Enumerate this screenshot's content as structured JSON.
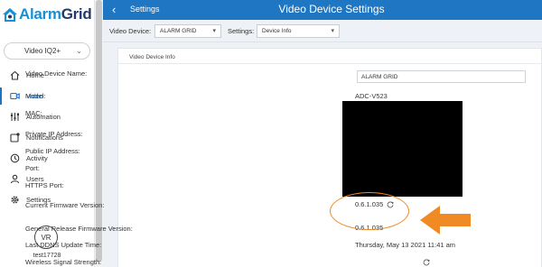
{
  "brand": {
    "alarm": "Alarm",
    "grid": "Grid",
    "alarm_color": "#1a8fd4",
    "grid_color": "#223a6b"
  },
  "system_selector": {
    "value": "Video IQ2+"
  },
  "nav": [
    {
      "label": "Home",
      "icon": "home-icon",
      "active": false
    },
    {
      "label": "Video",
      "icon": "video-camera-icon",
      "active": true
    },
    {
      "label": "Automation",
      "icon": "automation-icon",
      "active": false
    },
    {
      "label": "Notifications",
      "icon": "notifications-icon",
      "active": false
    },
    {
      "label": "Activity",
      "icon": "activity-icon",
      "active": false
    },
    {
      "label": "Users",
      "icon": "users-icon",
      "active": false
    },
    {
      "label": "Settings",
      "icon": "gear-icon",
      "active": false
    }
  ],
  "user": {
    "initials": "VR",
    "username": "test17728"
  },
  "header": {
    "back_label": "Settings",
    "title": "Video Device Settings",
    "color": "#1f76c3"
  },
  "toolbar": {
    "device_label": "Video Device:",
    "device_value": "ALARM GRID",
    "settings_label": "Settings:",
    "settings_value": "Device Info"
  },
  "card": {
    "title": "Video Device Info",
    "rows": [
      {
        "label": "Video Device Name:",
        "value": "ALARM GRID"
      },
      {
        "label": "Model:",
        "value": "ADC-V523"
      },
      {
        "label": "MAC:",
        "value": ""
      },
      {
        "label": "Private IP Address:",
        "value": ""
      },
      {
        "label": "Public IP Address:",
        "value": ""
      },
      {
        "label": "Port:",
        "value": ""
      },
      {
        "label": "HTTPS Port:",
        "value": ""
      },
      {
        "label": "Current Firmware Version:",
        "value": "0.6.1.035"
      },
      {
        "label": "General Release Firmware Version:",
        "value": "0.6.1.035"
      },
      {
        "label": "Last DDNS Update Time:",
        "value": "Thursday, May 13 2021 11:41 am"
      },
      {
        "label": "Wireless Signal Strength:",
        "value": ""
      }
    ]
  },
  "annotation_color": "#f08a24"
}
